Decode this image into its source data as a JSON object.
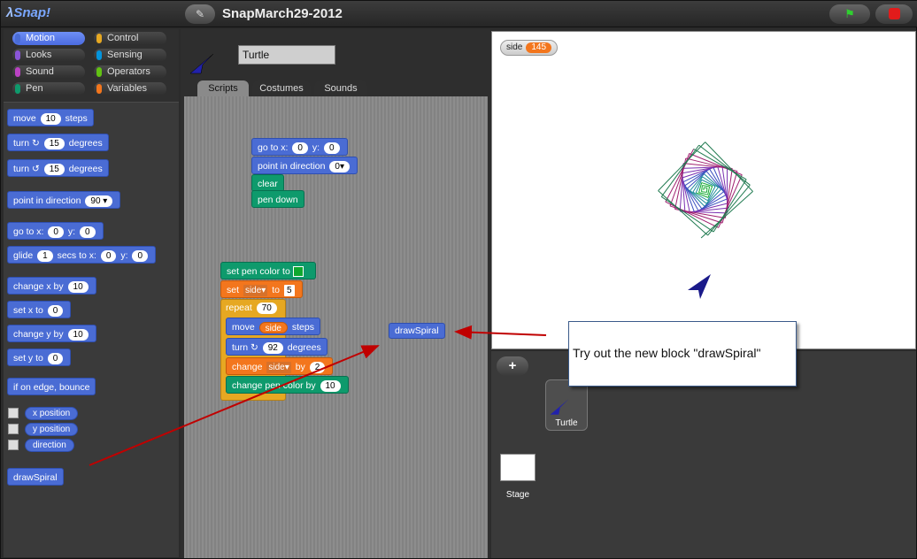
{
  "app": {
    "logo": "Snap!",
    "logo_lambda": "λ",
    "project_title": "SnapMarch29-2012",
    "cloud_icon": "✎"
  },
  "categories": [
    {
      "label": "Motion",
      "color": "#4a6cd4"
    },
    {
      "label": "Control",
      "color": "#e6a822"
    },
    {
      "label": "Looks",
      "color": "#8a55d7"
    },
    {
      "label": "Sensing",
      "color": "#0494dc"
    },
    {
      "label": "Sound",
      "color": "#bb42c3"
    },
    {
      "label": "Operators",
      "color": "#62c213"
    },
    {
      "label": "Pen",
      "color": "#0e9a6c"
    },
    {
      "label": "Variables",
      "color": "#f3761d"
    }
  ],
  "palette": {
    "move": {
      "a": "move",
      "v": "10",
      "b": "steps"
    },
    "turn_cw": {
      "a": "turn ↻",
      "v": "15",
      "b": "degrees"
    },
    "turn_ccw": {
      "a": "turn ↺",
      "v": "15",
      "b": "degrees"
    },
    "point": {
      "a": "point in direction",
      "v": "90"
    },
    "goto": {
      "a": "go to x:",
      "x": "0",
      "m": "y:",
      "y": "0"
    },
    "glide": {
      "a": "glide",
      "v": "1",
      "b": "secs to x:",
      "x": "0",
      "m": "y:",
      "y": "0"
    },
    "change_x": {
      "a": "change x by",
      "v": "10"
    },
    "set_x": {
      "a": "set x to",
      "v": "0"
    },
    "change_y": {
      "a": "change y by",
      "v": "10"
    },
    "set_y": {
      "a": "set y to",
      "v": "0"
    },
    "bounce": {
      "a": "if on edge, bounce"
    },
    "reporters": [
      "x position",
      "y position",
      "direction"
    ],
    "custom": "drawSpiral"
  },
  "sprite": {
    "name": "Turtle"
  },
  "tabs": [
    "Scripts",
    "Costumes",
    "Sounds"
  ],
  "script1": {
    "goto": {
      "a": "go to x:",
      "x": "0",
      "m": "y:",
      "y": "0"
    },
    "point": {
      "a": "point in direction",
      "v": "0"
    },
    "clear": "clear",
    "pendown": "pen down"
  },
  "script2": {
    "setpen": "set pen color to",
    "setvar": {
      "a": "set",
      "var": "side",
      "m": "to",
      "v": "5"
    },
    "repeat": {
      "a": "repeat",
      "v": "70"
    },
    "move": {
      "a": "move",
      "var": "side",
      "b": "steps"
    },
    "turn": {
      "a": "turn ↻",
      "v": "92",
      "b": "degrees"
    },
    "change": {
      "a": "change",
      "var": "side",
      "m": "by",
      "v": "2"
    },
    "changepen": {
      "a": "change pen color by",
      "v": "10"
    }
  },
  "loose_block": "drawSpiral",
  "watcher": {
    "name": "side",
    "value": "145"
  },
  "corral": {
    "add": "+",
    "turtle": "Turtle",
    "stage": "Stage"
  },
  "callout": "Try out the new block \"drawSpiral\"",
  "colors": {
    "pen_swatch": "#0fa82e",
    "arrow": "#c00000"
  }
}
